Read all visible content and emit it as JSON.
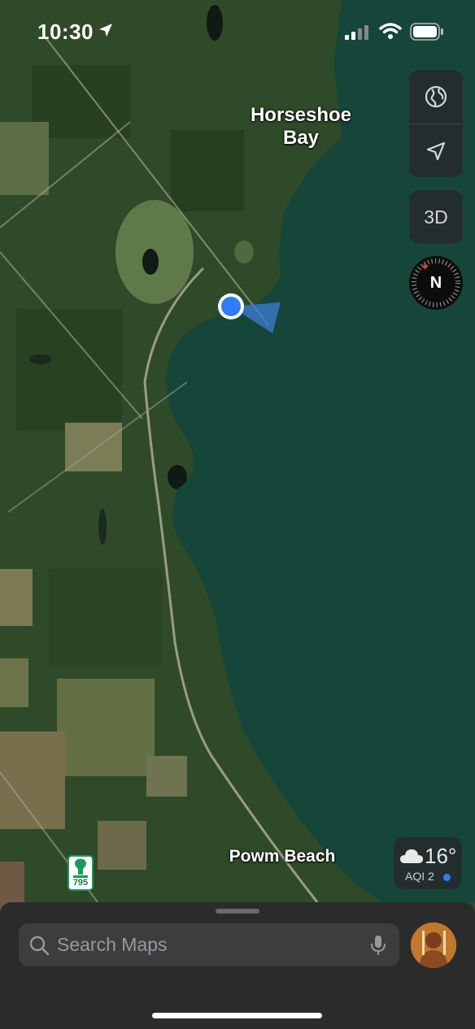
{
  "status_bar": {
    "time": "10:30"
  },
  "map": {
    "labels": {
      "horseshoe_line1": "Horseshoe",
      "horseshoe_line2": "Bay",
      "powm_beach": "Powm Beach"
    },
    "route_shield": "795",
    "view_toggle_label": "3D",
    "compass_label": "N"
  },
  "weather": {
    "temperature": "16°",
    "aqi": "AQI 2"
  },
  "search": {
    "placeholder": "Search Maps"
  },
  "colors": {
    "water": "#16463a",
    "land": "#2f4a28",
    "accent_blue": "#2f7cf6",
    "route_green": "#1a9a5a"
  }
}
